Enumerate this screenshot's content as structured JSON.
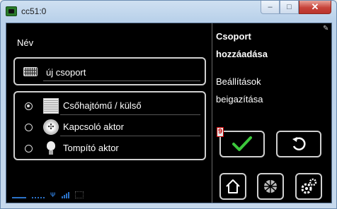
{
  "window": {
    "title": "cc51:0",
    "minimize": "–",
    "maximize": "□",
    "close": "✕"
  },
  "form": {
    "name_label": "Név",
    "name_value": "új csoport",
    "options": [
      {
        "label": "Csőhajtómű / külső",
        "icon": "blind-icon",
        "selected": true
      },
      {
        "label": "Kapcsoló aktor",
        "icon": "switch-icon",
        "selected": false
      },
      {
        "label": "Tompító aktor",
        "icon": "bulb-icon",
        "selected": false
      }
    ]
  },
  "panel": {
    "title_line1": "Csoport",
    "title_line2": "hozzáadása",
    "settings_line1": "Beállítások",
    "settings_line2": "beigazítása",
    "badge": "9"
  },
  "colors": {
    "accent_check": "#3cc83c",
    "status_blue": "#2b73c9",
    "background": "#000000"
  }
}
